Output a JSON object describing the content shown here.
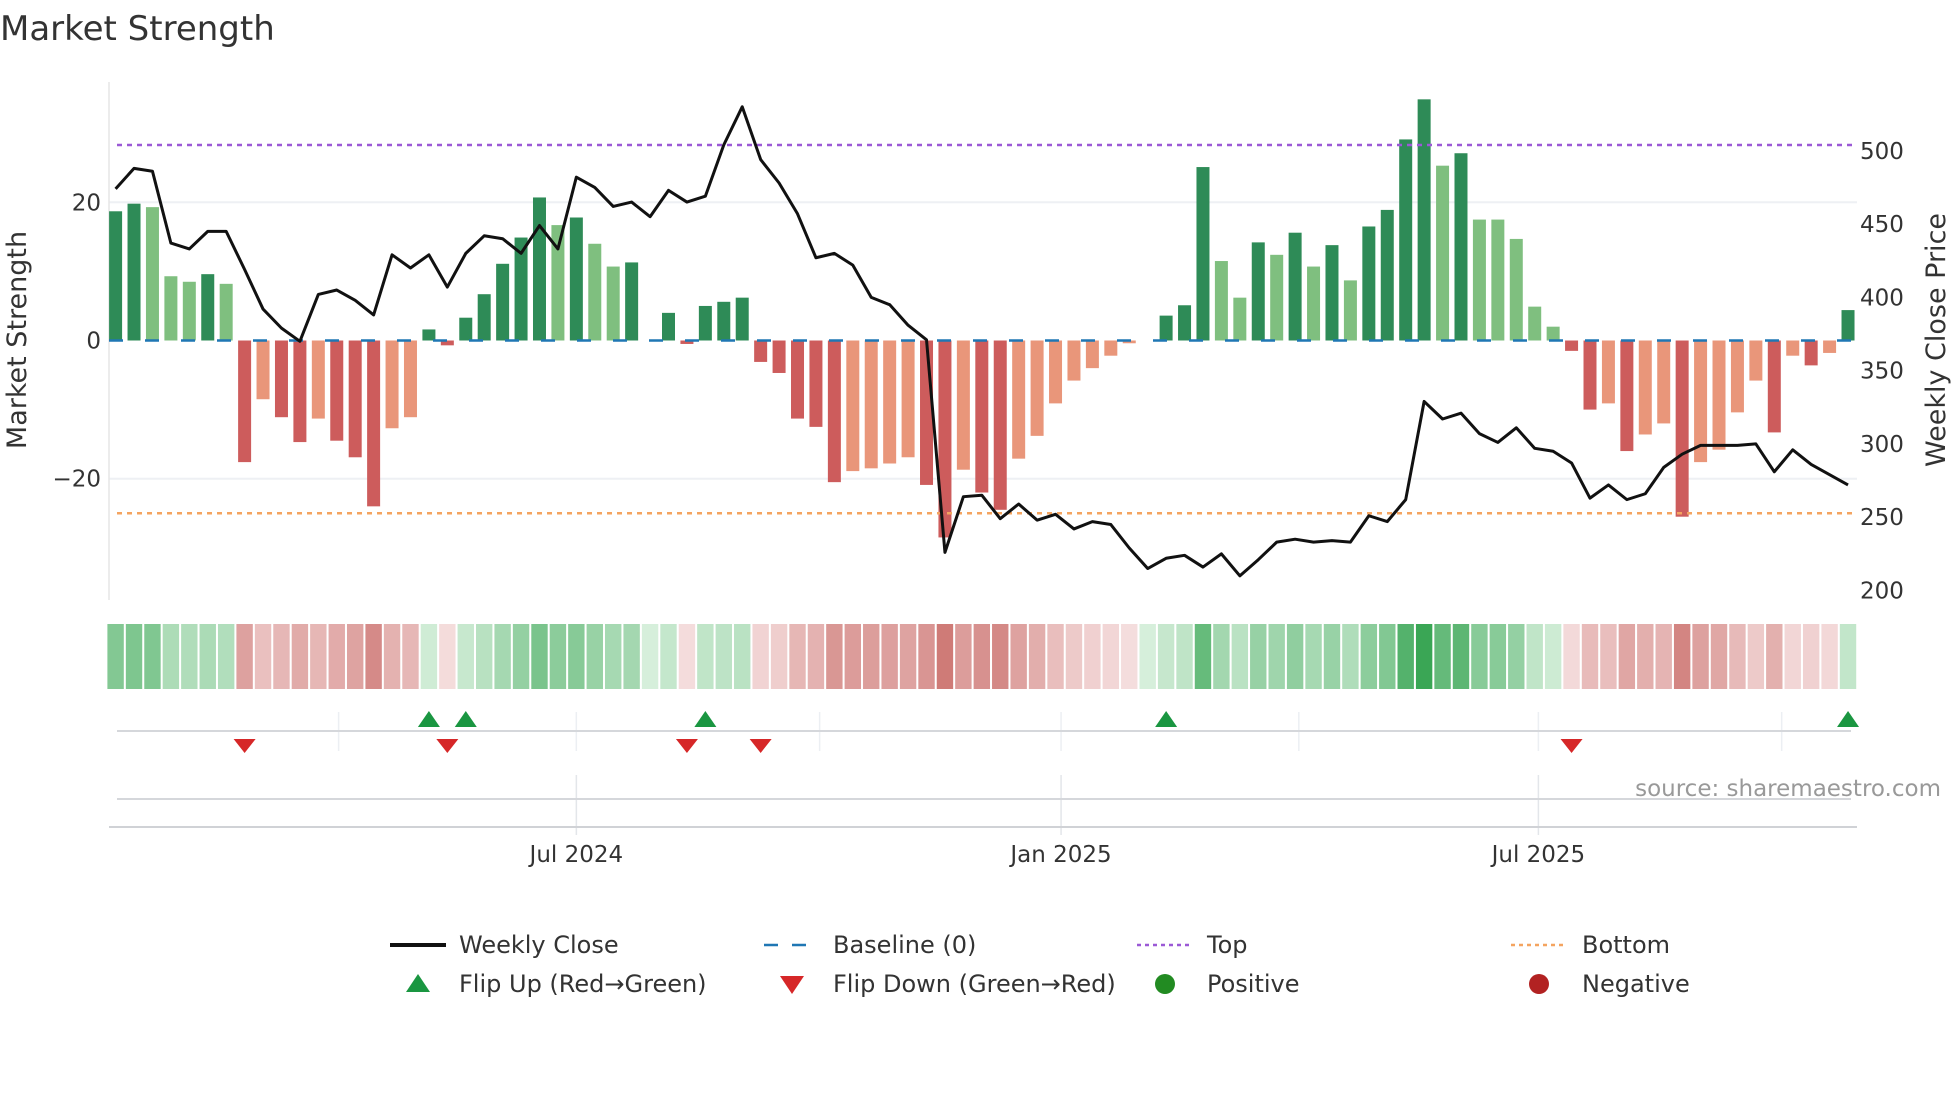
{
  "chart_data": {
    "type": "bar",
    "title": "Market Strength",
    "ylabel": "Market Strength",
    "y2label": "Weekly Close Price",
    "ylim": [
      -38,
      38
    ],
    "y2lim": [
      193,
      558
    ],
    "yticks": [
      20,
      0,
      -20
    ],
    "ytick_labels": [
      "20",
      "0",
      "−20"
    ],
    "y2ticks": [
      500,
      450,
      400,
      350,
      300,
      250,
      200
    ],
    "y2tick_labels": [
      "500",
      "450",
      "400",
      "350",
      "300",
      "250",
      "200"
    ],
    "xticks": [
      {
        "week": 25.0,
        "label": "Jul 2024"
      },
      {
        "week": 51.3,
        "label": "Jan 2025"
      },
      {
        "week": 77.2,
        "label": "Jul 2025"
      }
    ],
    "quarter_grid_weeks": [
      12.1,
      25.0,
      38.2,
      51.3,
      64.2,
      77.2,
      90.4
    ],
    "top_level": 28.3,
    "bottom_level": -25.0,
    "baseline": 0,
    "strength": [
      18.7,
      19.8,
      19.3,
      9.3,
      8.5,
      9.6,
      8.2,
      -17.6,
      -8.5,
      -11.1,
      -14.7,
      -11.3,
      -14.5,
      -16.9,
      -24.0,
      -12.7,
      -11.1,
      1.6,
      -0.7,
      3.3,
      6.7,
      11.1,
      14.9,
      20.7,
      16.7,
      17.8,
      14.0,
      10.7,
      11.3,
      0,
      4.0,
      -0.5,
      5.0,
      5.6,
      6.2,
      -3.1,
      -4.7,
      -11.3,
      -12.5,
      -20.5,
      -18.9,
      -18.5,
      -17.8,
      -16.9,
      -20.9,
      -28.5,
      -18.7,
      -22.0,
      -24.5,
      -17.1,
      -13.8,
      -9.1,
      -5.8,
      -4.0,
      -2.2,
      -0.4,
      0,
      3.6,
      5.1,
      25.1,
      11.5,
      6.2,
      14.2,
      12.4,
      15.6,
      10.7,
      13.8,
      8.7,
      16.5,
      18.9,
      29.1,
      34.9,
      25.3,
      27.1,
      17.5,
      17.5,
      14.7,
      4.9,
      2.0,
      -1.5,
      -10.0,
      -9.1,
      -16.0,
      -13.6,
      -12.0,
      -25.5,
      -17.6,
      -15.8,
      -10.4,
      -5.8,
      -13.3,
      -2.2,
      -3.6,
      -1.8,
      4.4
    ],
    "strong": [
      1,
      1,
      0,
      0,
      0,
      1,
      0,
      1,
      0,
      1,
      1,
      0,
      1,
      1,
      1,
      0,
      0,
      1,
      1,
      1,
      1,
      1,
      1,
      1,
      0,
      1,
      0,
      0,
      1,
      1,
      1,
      1,
      1,
      1,
      1,
      1,
      1,
      1,
      1,
      1,
      0,
      0,
      0,
      0,
      1,
      1,
      0,
      1,
      1,
      0,
      0,
      0,
      0,
      0,
      0,
      0,
      0,
      1,
      1,
      1,
      0,
      0,
      1,
      0,
      1,
      0,
      1,
      0,
      1,
      1,
      1,
      1,
      0,
      1,
      0,
      0,
      0,
      0,
      0,
      1,
      1,
      0,
      1,
      0,
      0,
      1,
      0,
      0,
      0,
      0,
      1,
      0,
      1,
      0,
      1
    ],
    "weekly_close": [
      474,
      488,
      486,
      437,
      433,
      445,
      445,
      419,
      392,
      379,
      370,
      402,
      405,
      398,
      388,
      429,
      420,
      429,
      407,
      430,
      442,
      440,
      430,
      449,
      433,
      482,
      475,
      462,
      465,
      455,
      473,
      465,
      469,
      504,
      530,
      494,
      478,
      457,
      427,
      430,
      422,
      400,
      395,
      381,
      371,
      226,
      264,
      265,
      249,
      259,
      248,
      252,
      242,
      247,
      245,
      229,
      215,
      222,
      224,
      216,
      225,
      210,
      221,
      233,
      235,
      233,
      234,
      233,
      251,
      247,
      262,
      329,
      317,
      321,
      307,
      301,
      311,
      297,
      295,
      287,
      263,
      272,
      262,
      266,
      284,
      293,
      299,
      299,
      299,
      300,
      281,
      296,
      286,
      279,
      272
    ],
    "flip_up_weeks": [
      17,
      19,
      32,
      57,
      94
    ],
    "flip_down_weeks": [
      7,
      18,
      31,
      35,
      79
    ],
    "legend": [
      {
        "label": "Weekly Close",
        "symbol": "line",
        "color": "#111111"
      },
      {
        "label": "Baseline (0)",
        "symbol": "dash",
        "color": "#1f77b4"
      },
      {
        "label": "Top",
        "symbol": "dot",
        "color": "#9b59d6"
      },
      {
        "label": "Bottom",
        "symbol": "dot",
        "color": "#f4a460"
      },
      {
        "label": "Flip Up (Red→Green)",
        "symbol": "triangle-up",
        "color": "#1a9641"
      },
      {
        "label": "Flip Down (Green→Red)",
        "symbol": "triangle-down",
        "color": "#d62728"
      },
      {
        "label": "Positive",
        "symbol": "circle",
        "color": "#228b22"
      },
      {
        "label": "Negative",
        "symbol": "circle",
        "color": "#b22222"
      }
    ],
    "legend_position": "bottom",
    "source": "source: sharemaestro.com",
    "colors": {
      "strong_pos": "#2e8b57",
      "weak_pos": "#7fbf7f",
      "strong_neg": "#cd5c5c",
      "weak_neg": "#e9967a"
    }
  }
}
